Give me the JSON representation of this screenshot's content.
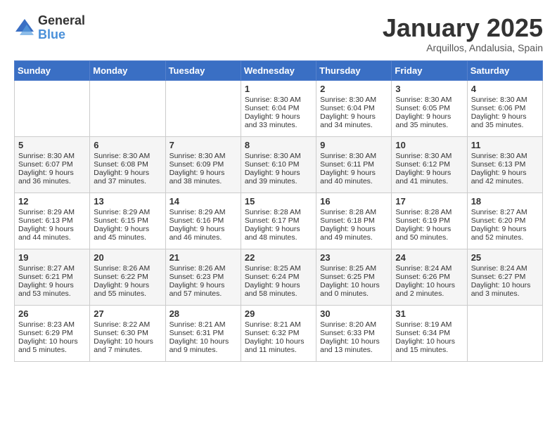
{
  "logo": {
    "general": "General",
    "blue": "Blue"
  },
  "title": "January 2025",
  "location": "Arquillos, Andalusia, Spain",
  "headers": [
    "Sunday",
    "Monday",
    "Tuesday",
    "Wednesday",
    "Thursday",
    "Friday",
    "Saturday"
  ],
  "weeks": [
    [
      {
        "day": "",
        "info": ""
      },
      {
        "day": "",
        "info": ""
      },
      {
        "day": "",
        "info": ""
      },
      {
        "day": "1",
        "info": "Sunrise: 8:30 AM\nSunset: 6:04 PM\nDaylight: 9 hours and 33 minutes."
      },
      {
        "day": "2",
        "info": "Sunrise: 8:30 AM\nSunset: 6:04 PM\nDaylight: 9 hours and 34 minutes."
      },
      {
        "day": "3",
        "info": "Sunrise: 8:30 AM\nSunset: 6:05 PM\nDaylight: 9 hours and 35 minutes."
      },
      {
        "day": "4",
        "info": "Sunrise: 8:30 AM\nSunset: 6:06 PM\nDaylight: 9 hours and 35 minutes."
      }
    ],
    [
      {
        "day": "5",
        "info": "Sunrise: 8:30 AM\nSunset: 6:07 PM\nDaylight: 9 hours and 36 minutes."
      },
      {
        "day": "6",
        "info": "Sunrise: 8:30 AM\nSunset: 6:08 PM\nDaylight: 9 hours and 37 minutes."
      },
      {
        "day": "7",
        "info": "Sunrise: 8:30 AM\nSunset: 6:09 PM\nDaylight: 9 hours and 38 minutes."
      },
      {
        "day": "8",
        "info": "Sunrise: 8:30 AM\nSunset: 6:10 PM\nDaylight: 9 hours and 39 minutes."
      },
      {
        "day": "9",
        "info": "Sunrise: 8:30 AM\nSunset: 6:11 PM\nDaylight: 9 hours and 40 minutes."
      },
      {
        "day": "10",
        "info": "Sunrise: 8:30 AM\nSunset: 6:12 PM\nDaylight: 9 hours and 41 minutes."
      },
      {
        "day": "11",
        "info": "Sunrise: 8:30 AM\nSunset: 6:13 PM\nDaylight: 9 hours and 42 minutes."
      }
    ],
    [
      {
        "day": "12",
        "info": "Sunrise: 8:29 AM\nSunset: 6:13 PM\nDaylight: 9 hours and 44 minutes."
      },
      {
        "day": "13",
        "info": "Sunrise: 8:29 AM\nSunset: 6:15 PM\nDaylight: 9 hours and 45 minutes."
      },
      {
        "day": "14",
        "info": "Sunrise: 8:29 AM\nSunset: 6:16 PM\nDaylight: 9 hours and 46 minutes."
      },
      {
        "day": "15",
        "info": "Sunrise: 8:28 AM\nSunset: 6:17 PM\nDaylight: 9 hours and 48 minutes."
      },
      {
        "day": "16",
        "info": "Sunrise: 8:28 AM\nSunset: 6:18 PM\nDaylight: 9 hours and 49 minutes."
      },
      {
        "day": "17",
        "info": "Sunrise: 8:28 AM\nSunset: 6:19 PM\nDaylight: 9 hours and 50 minutes."
      },
      {
        "day": "18",
        "info": "Sunrise: 8:27 AM\nSunset: 6:20 PM\nDaylight: 9 hours and 52 minutes."
      }
    ],
    [
      {
        "day": "19",
        "info": "Sunrise: 8:27 AM\nSunset: 6:21 PM\nDaylight: 9 hours and 53 minutes."
      },
      {
        "day": "20",
        "info": "Sunrise: 8:26 AM\nSunset: 6:22 PM\nDaylight: 9 hours and 55 minutes."
      },
      {
        "day": "21",
        "info": "Sunrise: 8:26 AM\nSunset: 6:23 PM\nDaylight: 9 hours and 57 minutes."
      },
      {
        "day": "22",
        "info": "Sunrise: 8:25 AM\nSunset: 6:24 PM\nDaylight: 9 hours and 58 minutes."
      },
      {
        "day": "23",
        "info": "Sunrise: 8:25 AM\nSunset: 6:25 PM\nDaylight: 10 hours and 0 minutes."
      },
      {
        "day": "24",
        "info": "Sunrise: 8:24 AM\nSunset: 6:26 PM\nDaylight: 10 hours and 2 minutes."
      },
      {
        "day": "25",
        "info": "Sunrise: 8:24 AM\nSunset: 6:27 PM\nDaylight: 10 hours and 3 minutes."
      }
    ],
    [
      {
        "day": "26",
        "info": "Sunrise: 8:23 AM\nSunset: 6:29 PM\nDaylight: 10 hours and 5 minutes."
      },
      {
        "day": "27",
        "info": "Sunrise: 8:22 AM\nSunset: 6:30 PM\nDaylight: 10 hours and 7 minutes."
      },
      {
        "day": "28",
        "info": "Sunrise: 8:21 AM\nSunset: 6:31 PM\nDaylight: 10 hours and 9 minutes."
      },
      {
        "day": "29",
        "info": "Sunrise: 8:21 AM\nSunset: 6:32 PM\nDaylight: 10 hours and 11 minutes."
      },
      {
        "day": "30",
        "info": "Sunrise: 8:20 AM\nSunset: 6:33 PM\nDaylight: 10 hours and 13 minutes."
      },
      {
        "day": "31",
        "info": "Sunrise: 8:19 AM\nSunset: 6:34 PM\nDaylight: 10 hours and 15 minutes."
      },
      {
        "day": "",
        "info": ""
      }
    ]
  ]
}
